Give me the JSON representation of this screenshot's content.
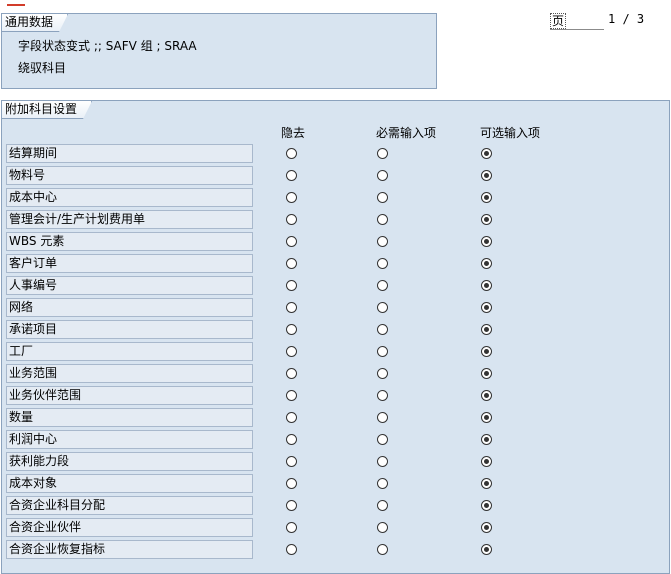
{
  "general": {
    "title": "通用数据",
    "field_status_line": "字段状态变式 ;; SAFV      组 ; SRAA",
    "account_line": "绕驭科目"
  },
  "pager": {
    "page_label": "页",
    "page_number": "1 / 3"
  },
  "additional": {
    "title": "附加科目设置",
    "columns": {
      "hide": "隐去",
      "required": "必需输入项",
      "optional": "可选输入项"
    },
    "rows": [
      {
        "label": "结算期间",
        "selected": "optional"
      },
      {
        "label": "物料号",
        "selected": "optional"
      },
      {
        "label": "成本中心",
        "selected": "optional"
      },
      {
        "label": "管理会计/生产计划费用单",
        "selected": "optional"
      },
      {
        "label": "WBS 元素",
        "selected": "optional"
      },
      {
        "label": "客户订单",
        "selected": "optional"
      },
      {
        "label": "人事编号",
        "selected": "optional"
      },
      {
        "label": "网络",
        "selected": "optional"
      },
      {
        "label": "承诺项目",
        "selected": "optional"
      },
      {
        "label": "工厂",
        "selected": "optional"
      },
      {
        "label": "业务范围",
        "selected": "optional"
      },
      {
        "label": "业务伙伴范围",
        "selected": "optional"
      },
      {
        "label": "数量",
        "selected": "optional"
      },
      {
        "label": "利润中心",
        "selected": "optional"
      },
      {
        "label": "获利能力段",
        "selected": "optional"
      },
      {
        "label": "成本对象",
        "selected": "optional"
      },
      {
        "label": "合资企业科目分配",
        "selected": "optional"
      },
      {
        "label": "合资企业伙伴",
        "selected": "optional"
      },
      {
        "label": "合资企业恢复指标",
        "selected": "optional"
      }
    ]
  }
}
